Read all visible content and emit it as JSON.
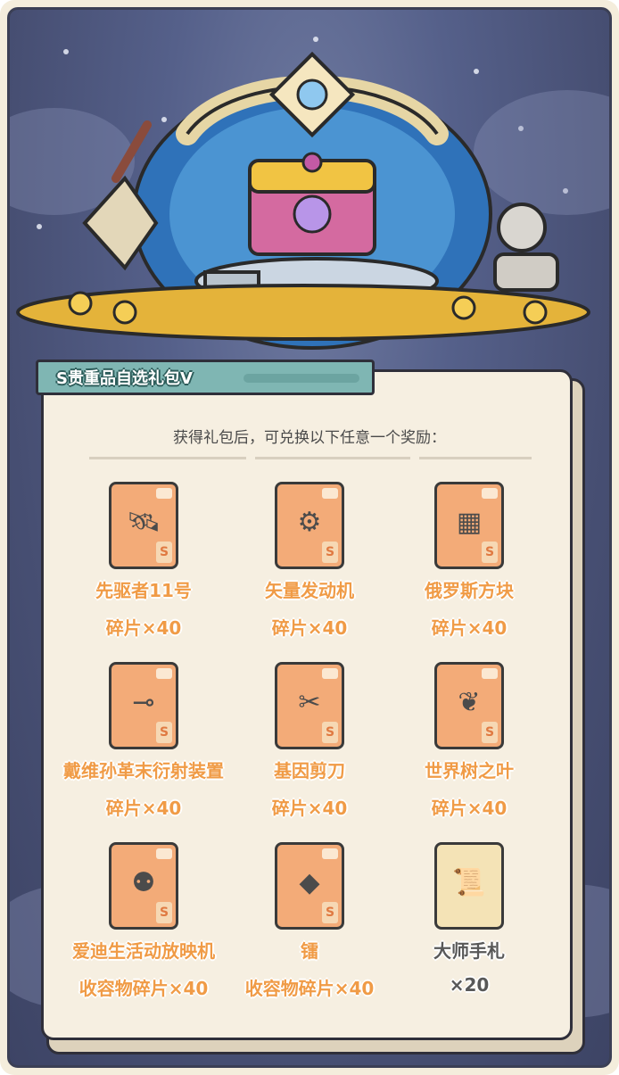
{
  "package": {
    "title": "S贵重品自选礼包Ⅴ",
    "subtitle": "获得礼包后，可兑换以下任意一个奖励："
  },
  "items": [
    {
      "name": "先驱者11号",
      "qty": "碎片×40",
      "icon": "probe-icon",
      "badge": "S"
    },
    {
      "name": "矢量发动机",
      "qty": "碎片×40",
      "icon": "engine-icon",
      "badge": "S"
    },
    {
      "name": "俄罗斯方块",
      "qty": "碎片×40",
      "icon": "cube-icon",
      "badge": "S"
    },
    {
      "name": "戴维孙革末衍射装置",
      "qty": "碎片×40",
      "icon": "diffraction-device-icon",
      "badge": "S"
    },
    {
      "name": "基因剪刀",
      "qty": "碎片×40",
      "icon": "gene-scissors-icon",
      "badge": "S"
    },
    {
      "name": "世界树之叶",
      "qty": "碎片×40",
      "icon": "leaf-icon",
      "badge": "S"
    },
    {
      "name": "爱迪生活动放映机",
      "qty": "收容物碎片×40",
      "icon": "projector-icon",
      "badge": "S"
    },
    {
      "name": "镭",
      "qty": "收容物碎片×40",
      "icon": "radium-crystal-icon",
      "badge": "S"
    },
    {
      "name": "大师手札",
      "qty": "×20",
      "icon": "scroll-icon",
      "badge": ""
    }
  ],
  "colors": {
    "accent": "#f09b46",
    "ribbon": "#7fb6b3",
    "panel": "#f6efe1"
  }
}
